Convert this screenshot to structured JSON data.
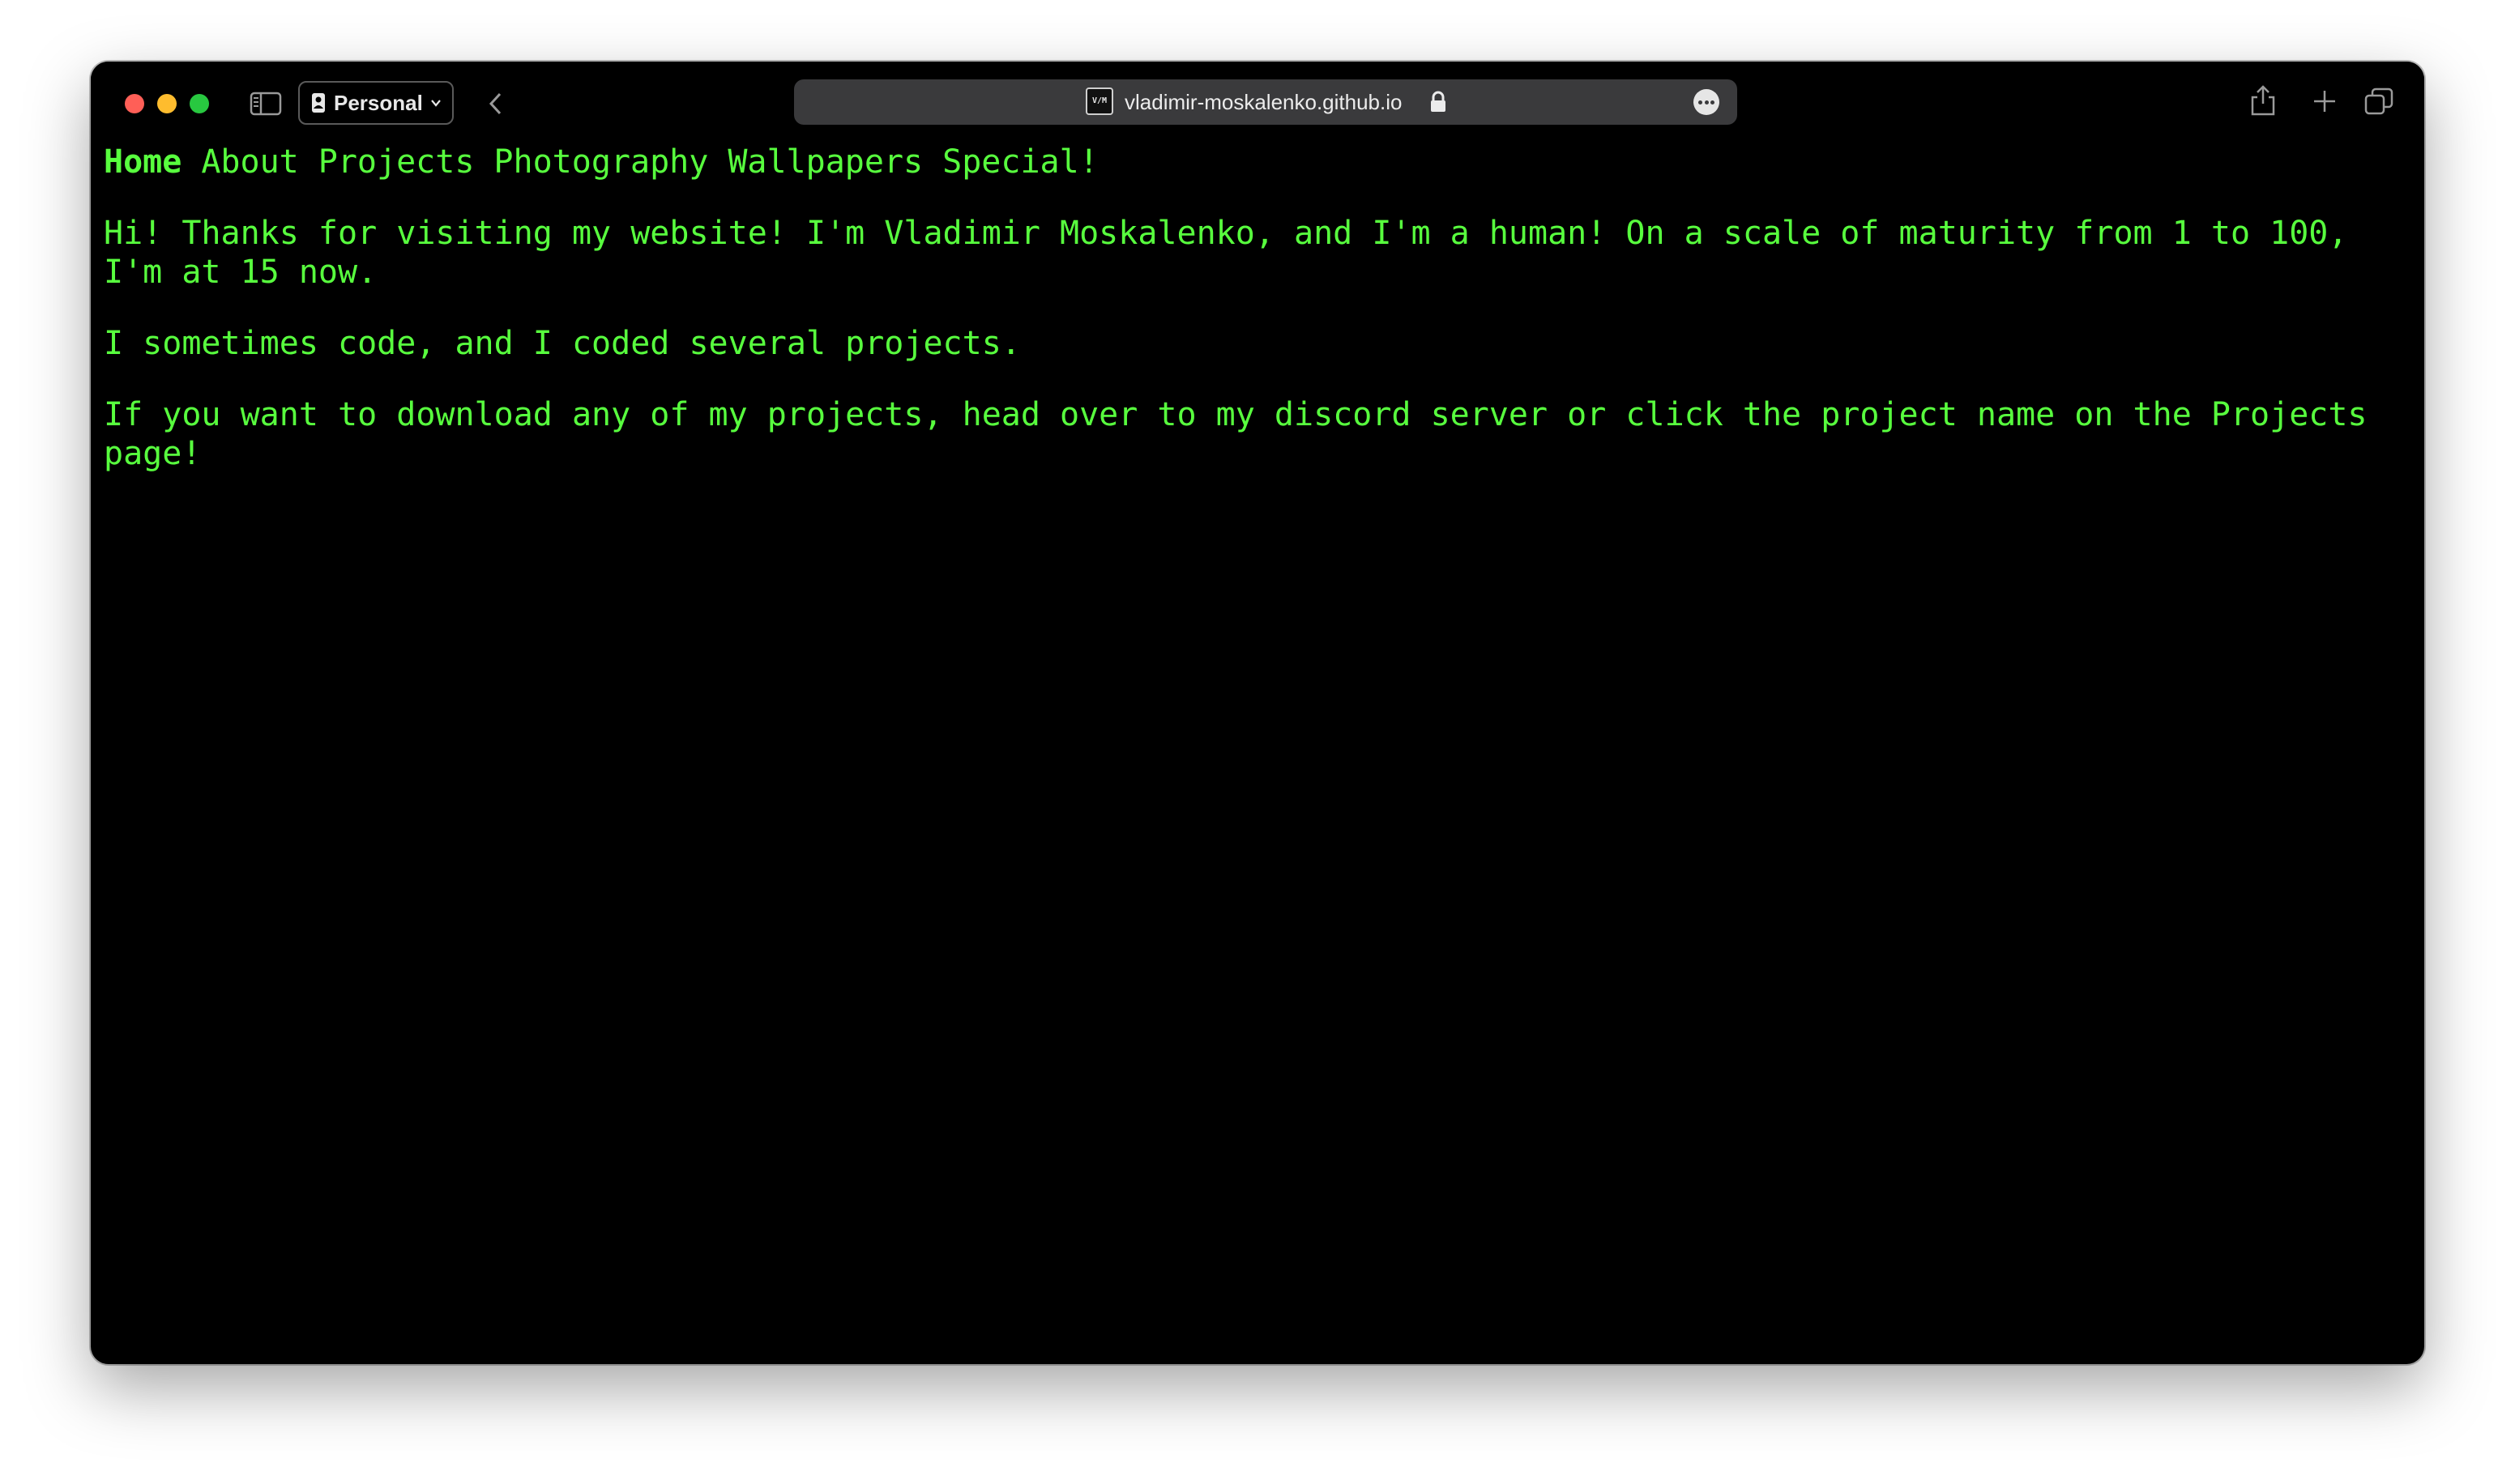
{
  "browser": {
    "profile_label": "Personal",
    "url": "vladimir-moskalenko.github.io",
    "favicon_text": "V/M",
    "icons": {
      "sidebar": "sidebar-icon",
      "back": "chevron-left-icon",
      "lock": "lock-icon",
      "more": "ellipsis-icon",
      "share": "share-icon",
      "new_tab": "plus-icon",
      "tabs": "tab-overview-icon"
    },
    "colors": {
      "close": "#ff5f57",
      "minimize": "#febc2e",
      "zoom": "#28c840",
      "address_bar": "#3a3a3c"
    }
  },
  "page": {
    "colors": {
      "background": "#000000",
      "text": "#58ff3e"
    },
    "nav": {
      "home": "Home",
      "about": "About",
      "projects": "Projects",
      "photography": "Photography",
      "wallpapers": "Wallpapers",
      "special": "Special!"
    },
    "paragraphs": {
      "intro": "Hi! Thanks for visiting my website! I'm Vladimir Moskalenko, and I'm a human! On a scale of maturity from 1 to 100, I'm at 15 now.",
      "code": "I sometimes code, and I coded several projects.",
      "download": "If you want to download any of my projects, head over to my discord server or click the project name on the Projects page!"
    }
  }
}
